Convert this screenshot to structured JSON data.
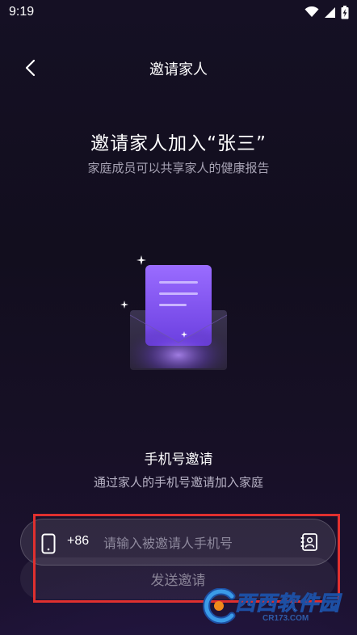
{
  "status_bar": {
    "time": "9:19",
    "icons": [
      "wifi-icon",
      "signal-icon",
      "battery-charging-icon"
    ]
  },
  "header": {
    "title": "邀请家人"
  },
  "hero": {
    "title": "邀请家人加入“张三”",
    "subtitle": "家庭成员可以共享家人的健康报告",
    "illustration": "envelope-letter-icon"
  },
  "phone_invite": {
    "title": "手机号邀请",
    "subtitle": "通过家人的手机号邀请加入家庭",
    "country_code": "+86",
    "input_value": "",
    "input_placeholder": "请输入被邀请人手机号",
    "send_label": "发送邀请"
  },
  "watermark": {
    "text": "西西软件园",
    "url": "CR173.COM"
  },
  "colors": {
    "accent_purple": "#8b5cf6",
    "highlight_red": "#e0302f"
  }
}
